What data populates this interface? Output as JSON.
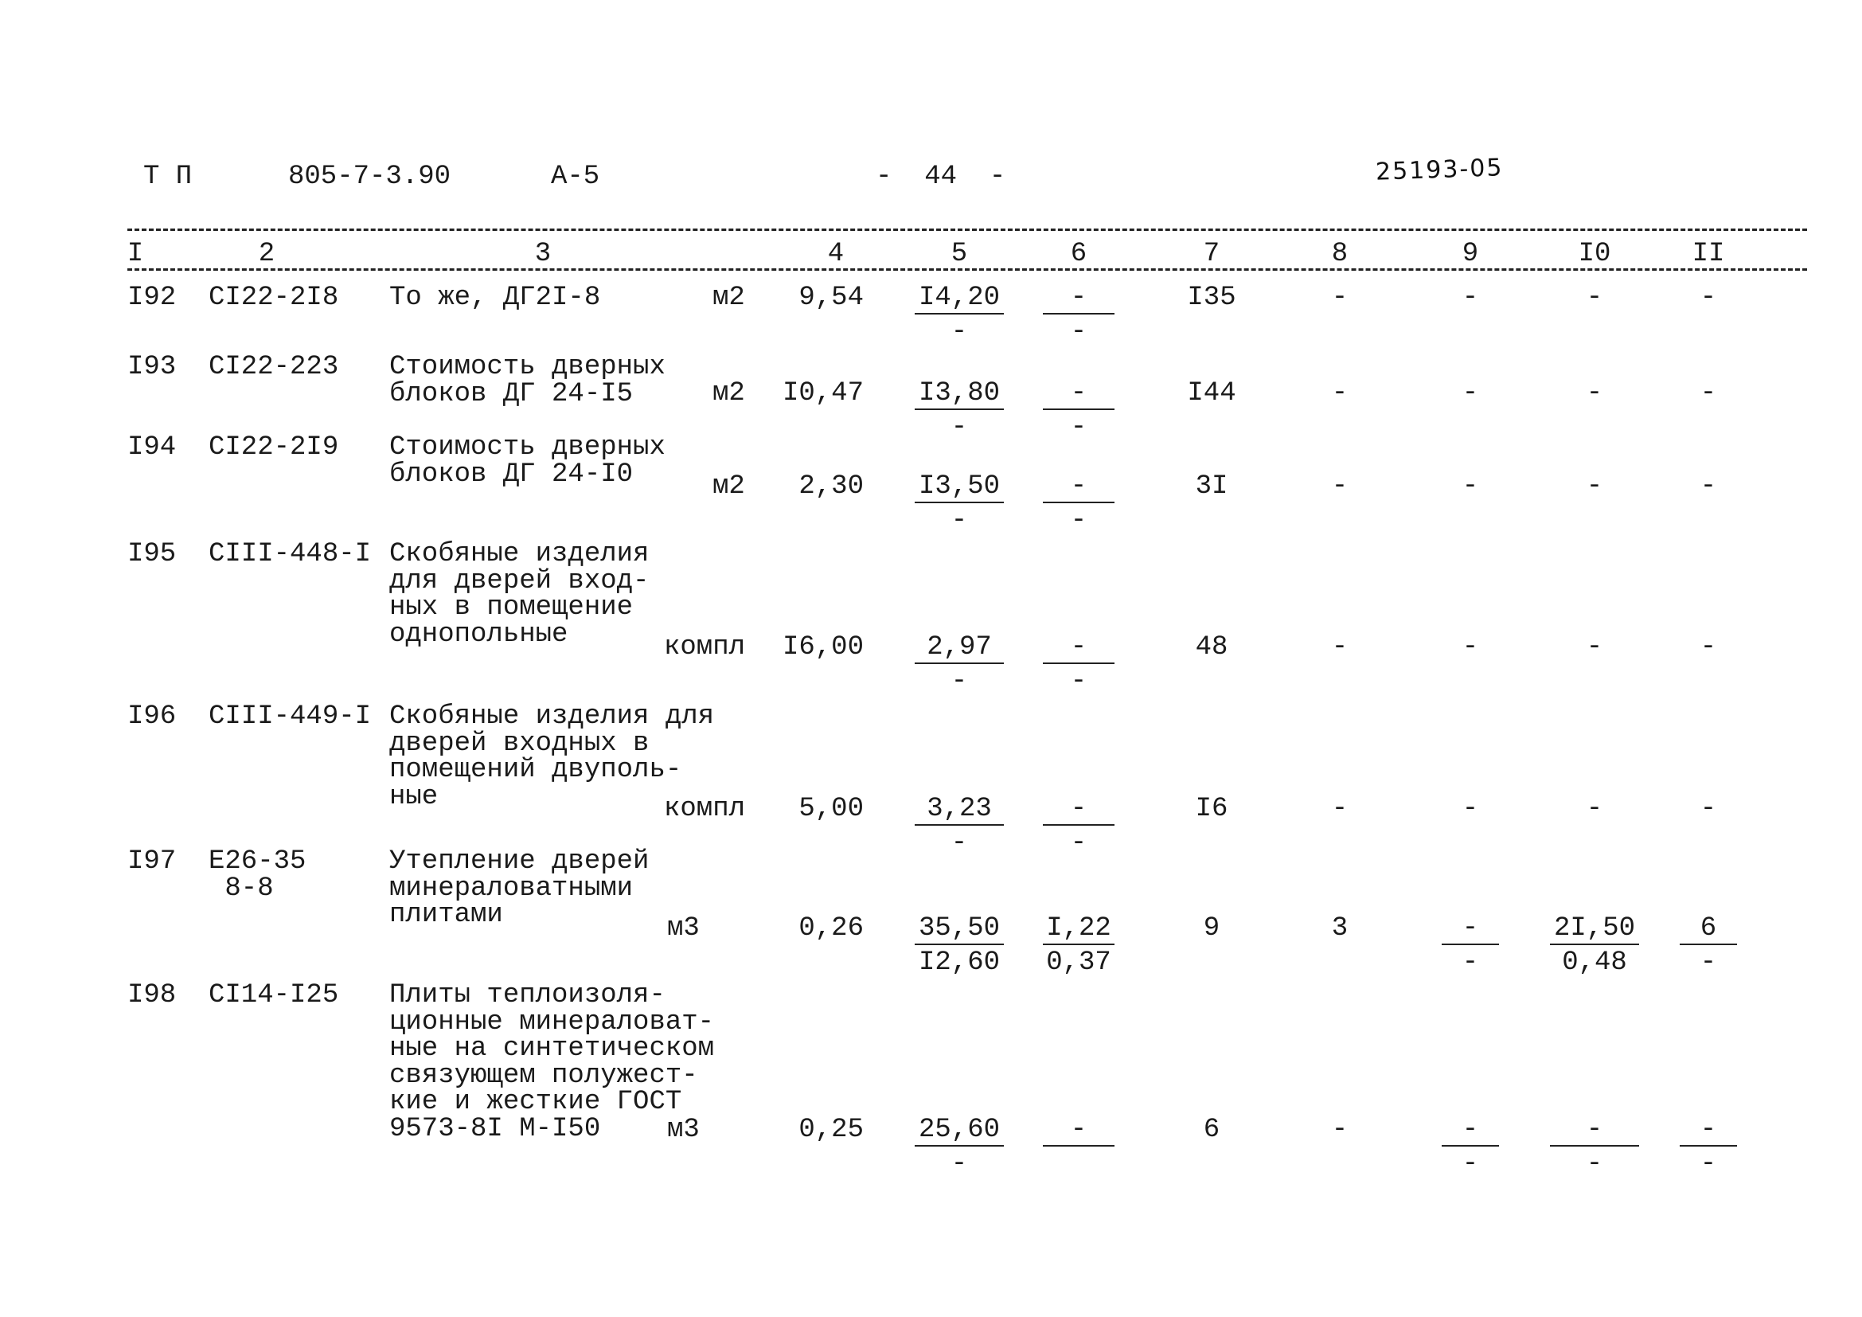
{
  "header": {
    "series": "Т П",
    "project": "805-7-3.90",
    "album": "А-5",
    "page": "-  44  -",
    "handwritten_ref": "25193-05"
  },
  "column_headers": [
    "I",
    "2",
    "3",
    "4",
    "5",
    "6",
    "7",
    "8",
    "9",
    "I0",
    "II"
  ],
  "rows": [
    {
      "num": "I92",
      "code": [
        "СI22-2I8"
      ],
      "desc": [
        "То же, ДГ2I-8"
      ],
      "unit": "м2",
      "qty": "9,54",
      "c5": {
        "top": "I4,20",
        "bottom": "-"
      },
      "c6": {
        "top": "-",
        "bottom": "-"
      },
      "c7": "I35",
      "c8": "-",
      "c9": "-",
      "c10": "-",
      "c11": "-"
    },
    {
      "num": "I93",
      "code": [
        "СI22-223"
      ],
      "desc": [
        "Стоимость дверных",
        "блоков ДГ 24-I5"
      ],
      "unit": "м2",
      "qty": "I0,47",
      "c5": {
        "top": "I3,80",
        "bottom": "-"
      },
      "c6": {
        "top": "-",
        "bottom": "-"
      },
      "c7": "I44",
      "c8": "-",
      "c9": "-",
      "c10": "-",
      "c11": "-"
    },
    {
      "num": "I94",
      "code": [
        "СI22-2I9"
      ],
      "desc": [
        "Стоимость дверных",
        "блоков ДГ 24-I0"
      ],
      "unit": "м2",
      "qty": "2,30",
      "c5": {
        "top": "I3,50",
        "bottom": "-"
      },
      "c6": {
        "top": "-",
        "bottom": "-"
      },
      "c7": "3I",
      "c8": "-",
      "c9": "-",
      "c10": "-",
      "c11": "-"
    },
    {
      "num": "I95",
      "code": [
        "СIII-448-I"
      ],
      "desc": [
        "Скобяные изделия",
        "для дверей вход-",
        "ных в помещение",
        "однопольные"
      ],
      "unit": "компл",
      "qty": "I6,00",
      "c5": {
        "top": "2,97",
        "bottom": "-"
      },
      "c6": {
        "top": "-",
        "bottom": "-"
      },
      "c7": "48",
      "c8": "-",
      "c9": "-",
      "c10": "-",
      "c11": "-"
    },
    {
      "num": "I96",
      "code": [
        "СIII-449-I"
      ],
      "desc": [
        "Скобяные изделия для",
        "дверей входных в",
        "помещений двуполь-",
        "ные"
      ],
      "unit": "компл",
      "qty": "5,00",
      "c5": {
        "top": "3,23",
        "bottom": "-"
      },
      "c6": {
        "top": "-",
        "bottom": "-"
      },
      "c7": "I6",
      "c8": "-",
      "c9": "-",
      "c10": "-",
      "c11": "-"
    },
    {
      "num": "I97",
      "code": [
        "Е26-35",
        " 8-8"
      ],
      "desc": [
        "Утепление дверей",
        "минераловатными",
        "плитами"
      ],
      "unit": "м3",
      "qty": "0,26",
      "c5": {
        "top": "35,50",
        "bottom": "I2,60"
      },
      "c6": {
        "top": "I,22",
        "bottom": "0,37"
      },
      "c7": "9",
      "c8": "3",
      "c9": {
        "top": "-",
        "bottom": "-"
      },
      "c10": {
        "top": "2I,50",
        "bottom": "0,48"
      },
      "c11": {
        "top": "6",
        "bottom": "-"
      }
    },
    {
      "num": "I98",
      "code": [
        "СI14-I25"
      ],
      "desc": [
        "Плиты теплоизоля-",
        "ционные минераловат-",
        "ные на синтетическом",
        "связующем полужест-",
        "кие и жесткие ГОСТ",
        "9573-8I М-I50"
      ],
      "unit": "м3",
      "qty": "0,25",
      "c5": {
        "top": "25,60",
        "bottom": "-"
      },
      "c6": {
        "top": "-",
        "bottom": ""
      },
      "c7": "6",
      "c8": "-",
      "c9": {
        "top": "-",
        "bottom": "-"
      },
      "c10": {
        "top": "-",
        "bottom": "-"
      },
      "c11": {
        "top": "-",
        "bottom": "-"
      }
    }
  ]
}
